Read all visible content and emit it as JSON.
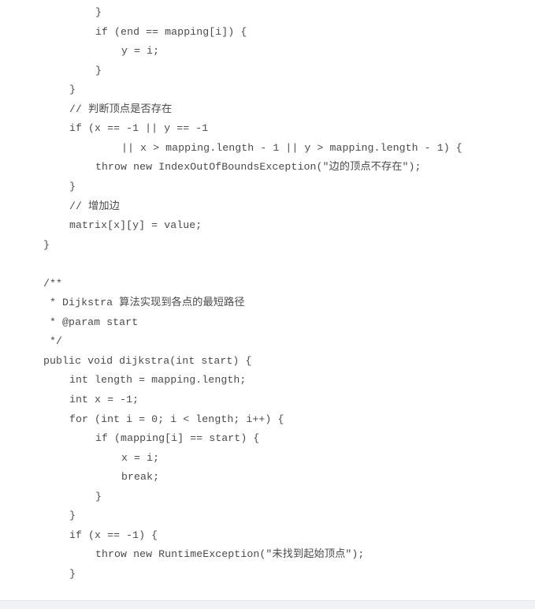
{
  "document": {
    "type": "code-listing",
    "language": "Java",
    "lines": [
      {
        "indent": 2,
        "text": "}"
      },
      {
        "indent": 2,
        "text": "if (end == mapping[i]) {"
      },
      {
        "indent": 3,
        "text": "y = i;"
      },
      {
        "indent": 2,
        "text": "}"
      },
      {
        "indent": 1,
        "text": "}"
      },
      {
        "indent": 1,
        "text": "// 判断顶点是否存在"
      },
      {
        "indent": 1,
        "text": "if (x == -1 || y == -1"
      },
      {
        "indent": 3,
        "text": "|| x > mapping.length - 1 || y > mapping.length - 1) {"
      },
      {
        "indent": 2,
        "text": "throw new IndexOutOfBoundsException(\"边的顶点不存在\");"
      },
      {
        "indent": 1,
        "text": "}"
      },
      {
        "indent": 1,
        "text": "// 增加边"
      },
      {
        "indent": 1,
        "text": "matrix[x][y] = value;"
      },
      {
        "indent": 0,
        "text": "}"
      },
      {
        "indent": 0,
        "text": ""
      },
      {
        "indent": 0,
        "text": "/**"
      },
      {
        "indent": 0,
        "text": " * Dijkstra 算法实现到各点的最短路径"
      },
      {
        "indent": 0,
        "text": " * @param start"
      },
      {
        "indent": 0,
        "text": " */"
      },
      {
        "indent": 0,
        "text": "public void dijkstra(int start) {"
      },
      {
        "indent": 1,
        "text": "int length = mapping.length;"
      },
      {
        "indent": 1,
        "text": "int x = -1;"
      },
      {
        "indent": 1,
        "text": "for (int i = 0; i < length; i++) {"
      },
      {
        "indent": 2,
        "text": "if (mapping[i] == start) {"
      },
      {
        "indent": 3,
        "text": "x = i;"
      },
      {
        "indent": 3,
        "text": "break;"
      },
      {
        "indent": 2,
        "text": "}"
      },
      {
        "indent": 1,
        "text": "}"
      },
      {
        "indent": 1,
        "text": "if (x == -1) {"
      },
      {
        "indent": 2,
        "text": "throw new RuntimeException(\"未找到起始顶点\");"
      },
      {
        "indent": 1,
        "text": "}"
      }
    ]
  },
  "colors": {
    "text": "#4a4a4a",
    "background": "#ffffff",
    "bottom_strip": "#f1f2f6"
  }
}
